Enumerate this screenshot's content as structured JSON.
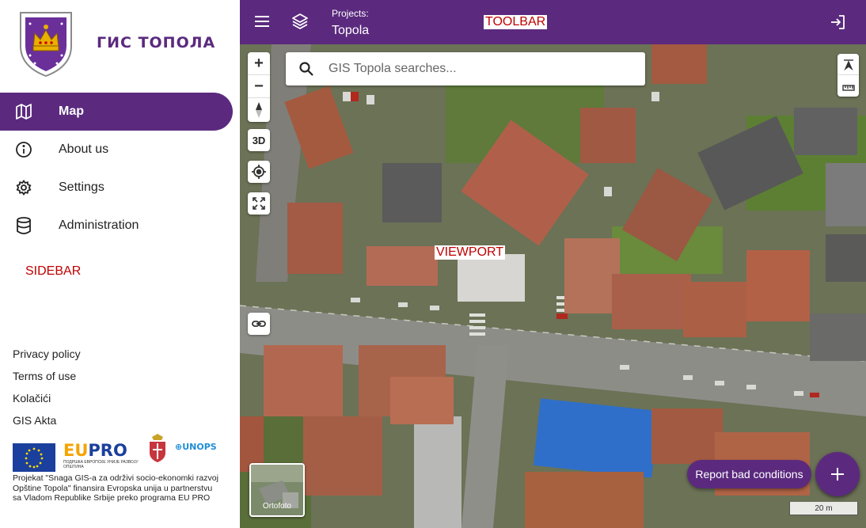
{
  "sidebar": {
    "brand": "ГИС ТОПОЛА",
    "items": [
      {
        "label": "Map",
        "icon": "map-icon",
        "active": true
      },
      {
        "label": "About us",
        "icon": "info-icon",
        "active": false
      },
      {
        "label": "Settings",
        "icon": "gear-icon",
        "active": false
      },
      {
        "label": "Administration",
        "icon": "database-icon",
        "active": false
      }
    ],
    "annotation": "SIDEBAR",
    "footer_links": [
      "Privacy policy",
      "Terms of use",
      "Kolačići",
      "GIS Akta"
    ],
    "partners": {
      "eu_label": "EU",
      "eupro_eu": "EU",
      "eupro_pro": "PRO",
      "eupro_sub": "ПОДРШКА ЕВРОПСКЕ УНИЈЕ РАЗВОЈУ ОПШТИНА",
      "unops": "UNOPS"
    },
    "project_text": "Projekat \"Snaga GIS-a za održivi socio-ekonomki razvoj Opštine Topola\" finansira Evropska unija u partnerstvu sa Vladom Republike Srbije preko programa EU PRO"
  },
  "toolbar": {
    "projects_label": "Projects:",
    "project_name": "Topola",
    "annotation": "TOOLBAR"
  },
  "viewport": {
    "annotation": "VIEWPORT",
    "search_placeholder": "GIS Topola searches...",
    "zoom_in": "+",
    "zoom_out": "−",
    "btn_3d": "3D",
    "basemap_label": "Ortofoto",
    "report_label": "Report bad conditions",
    "fab_label": "+",
    "scale_label": "20 m"
  },
  "colors": {
    "brand_purple": "#5b2a7e",
    "annotation_red": "#c00000"
  }
}
